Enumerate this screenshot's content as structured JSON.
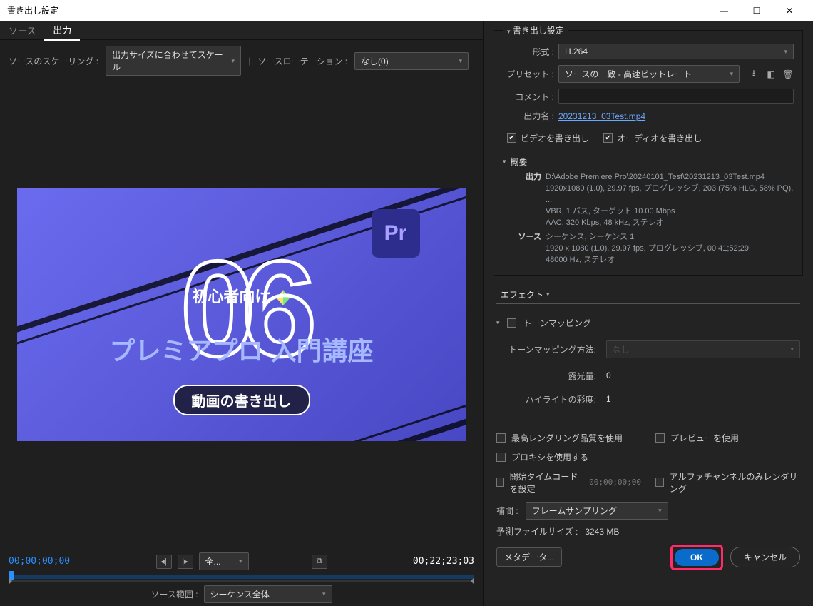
{
  "window": {
    "title": "書き出し設定"
  },
  "tabs": {
    "source": "ソース",
    "output": "出力"
  },
  "left": {
    "scaling_label": "ソースのスケーリング :",
    "scaling_value": "出力サイズに合わせてスケール",
    "rotation_label": "ソースローテーション :",
    "rotation_value": "なし(0)",
    "preview": {
      "tag": "初心者向け",
      "app_badge": "Pr",
      "number": "06",
      "course": "プレミアプロ 入門講座",
      "pill": "動画の書き出し"
    },
    "timecode_left": "00;00;00;00",
    "fit_label": "全...",
    "timecode_right": "00;22;23;03",
    "source_range_label": "ソース範囲 :",
    "source_range_value": "シーケンス全体"
  },
  "export": {
    "group_title": "書き出し設定",
    "format_label": "形式 :",
    "format_value": "H.264",
    "preset_label": "プリセット :",
    "preset_value": "ソースの一致 - 高速ビットレート",
    "comment_label": "コメント :",
    "comment_value": "",
    "output_name_label": "出力名 :",
    "output_name_value": "20231213_03Test.mp4",
    "export_video": "ビデオを書き出し",
    "export_audio": "オーディオを書き出し",
    "summary_label": "概要",
    "summary": {
      "out_key": "出力",
      "out1": "D:\\Adobe Premiere Pro\\20240101_Test\\20231213_03Test.mp4",
      "out2": "1920x1080 (1.0), 29.97 fps, プログレッシブ, 203 (75% HLG, 58% PQ), ...",
      "out3": "VBR, 1 パス, ターゲット 10.00 Mbps",
      "out4": "AAC, 320 Kbps, 48 kHz, ステレオ",
      "src_key": "ソース",
      "src1": "シーケンス, シーケンス 1",
      "src2": "1920 x 1080 (1.0), 29.97 fps, プログレッシブ, 00;41;52;29",
      "src3": "48000 Hz, ステレオ"
    }
  },
  "effects_tab": "エフェクト",
  "tone": {
    "title": "トーンマッピング",
    "method_label": "トーンマッピング方法:",
    "method_value": "なし",
    "exposure_label": "露光量:",
    "exposure_value": "0",
    "highlight_label": "ハイライトの彩度:",
    "highlight_value": "1"
  },
  "opts": {
    "max_quality": "最高レンダリング品質を使用",
    "use_preview": "プレビューを使用",
    "use_proxy": "プロキシを使用する",
    "set_timecode": "開始タイムコードを設定",
    "tc_zero": "00;00;00;00",
    "alpha_only": "アルファチャンネルのみレンダリング",
    "interp_label": "補間 :",
    "interp_value": "フレームサンプリング",
    "est_label": "予測ファイルサイズ :",
    "est_value": "3243 MB",
    "metadata": "メタデータ...",
    "ok": "OK",
    "cancel": "キャンセル"
  }
}
